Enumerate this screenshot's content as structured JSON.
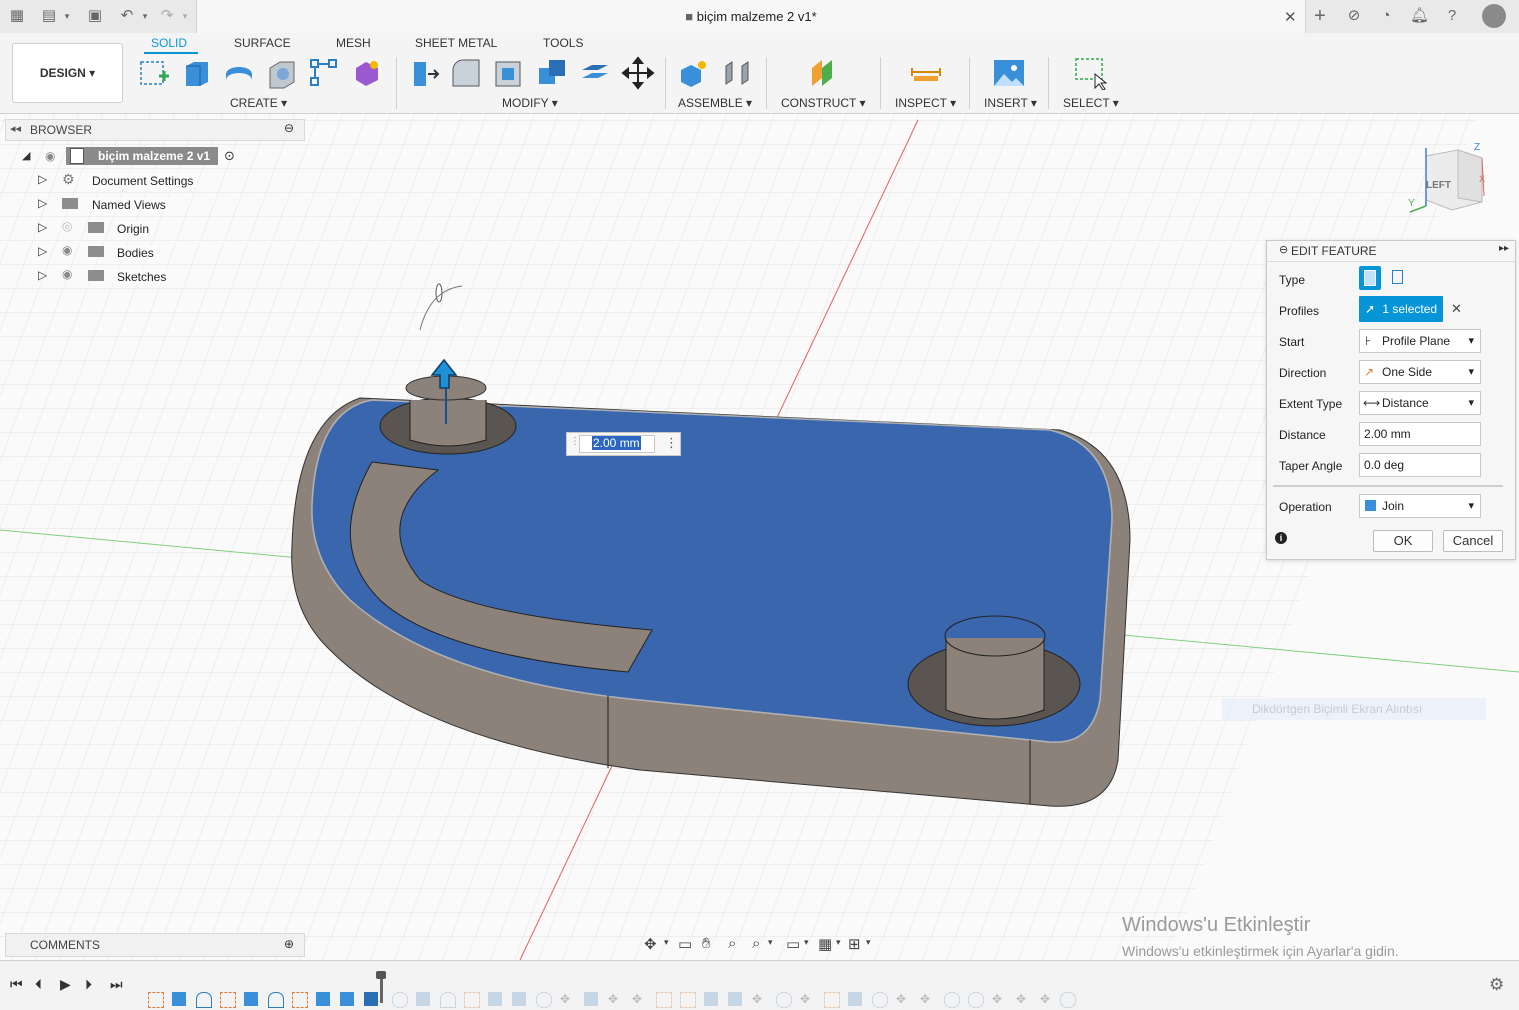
{
  "app": {
    "document_title": "biçim malzeme 2 v1*",
    "workspace_button": "DESIGN"
  },
  "toolbar": {
    "tabs": [
      "SOLID",
      "SURFACE",
      "MESH",
      "SHEET METAL",
      "TOOLS"
    ],
    "active_tab": "SOLID",
    "groups": {
      "create": "CREATE",
      "modify": "MODIFY",
      "assemble": "ASSEMBLE",
      "construct": "CONSTRUCT",
      "inspect": "INSPECT",
      "insert": "INSERT",
      "select": "SELECT"
    }
  },
  "browser": {
    "title": "BROWSER",
    "root": "biçim malzeme 2 v1",
    "items": [
      "Document Settings",
      "Named Views",
      "Origin",
      "Bodies",
      "Sketches"
    ]
  },
  "viewport": {
    "distance_input": "2.00 mm",
    "viewcube_face": "LEFT",
    "axis_z": "Z",
    "axis_y": "Y",
    "axis_x": "X",
    "faint_tooltip": "Dikdörtgen Biçimli Ekran Alıntısı"
  },
  "edit_feature": {
    "title": "EDIT FEATURE",
    "type_label": "Type",
    "profiles_label": "Profiles",
    "profiles_value": "1 selected",
    "start_label": "Start",
    "start_value": "Profile Plane",
    "direction_label": "Direction",
    "direction_value": "One Side",
    "extent_label": "Extent Type",
    "extent_value": "Distance",
    "distance_label": "Distance",
    "distance_value": "2.00 mm",
    "taper_label": "Taper Angle",
    "taper_value": "0.0 deg",
    "operation_label": "Operation",
    "operation_value": "Join",
    "ok": "OK",
    "cancel": "Cancel"
  },
  "comments": {
    "title": "COMMENTS"
  },
  "windows_watermark": {
    "line1": "Windows'u Etkinleştir",
    "line2": "Windows'u etkinleştirmek için Ayarlar'a gidin."
  },
  "colors": {
    "accent_blue": "#0696d7",
    "selected_face": "#3a66ad",
    "body_gray": "#8c8279"
  }
}
